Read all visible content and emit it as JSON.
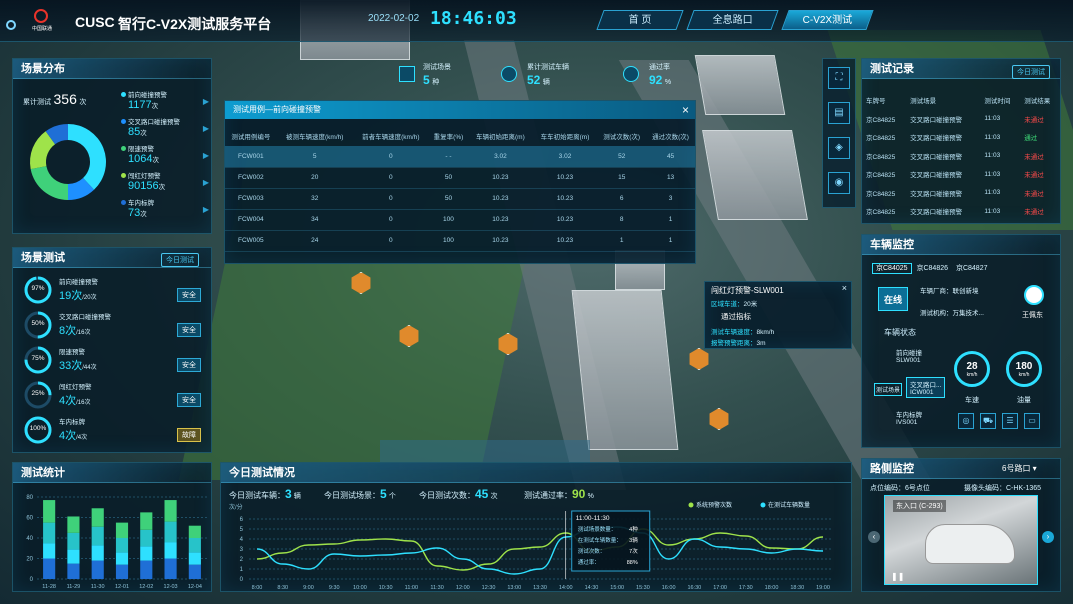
{
  "header": {
    "brand": "CUSC",
    "logo_text": "中国联通",
    "title": "智行C-V2X测试服务平台",
    "date": "2022-02-02",
    "time": "18:46:03",
    "tabs": [
      "首 页",
      "全息路口",
      "C-V2X测试"
    ],
    "active_tab": 2
  },
  "top_stats": [
    {
      "label": "测试场景",
      "value": "5",
      "unit": "种",
      "icon": "scene-icon"
    },
    {
      "label": "累计测试车辆",
      "value": "52",
      "unit": "辆",
      "icon": "car-icon"
    },
    {
      "label": "通过率",
      "value": "92",
      "unit": "%",
      "icon": "pie-icon"
    }
  ],
  "scene_dist": {
    "title": "场景分布",
    "total_label": "累计测试",
    "total": "356",
    "total_unit": "次",
    "items": [
      {
        "name": "前向碰撞预警",
        "value": "1177",
        "unit": "次",
        "color": "#2ee0ff"
      },
      {
        "name": "交叉路口碰撞预警",
        "value": "85",
        "unit": "次",
        "color": "#1e90ff"
      },
      {
        "name": "限速预警",
        "value": "1064",
        "unit": "次",
        "color": "#3fd17a"
      },
      {
        "name": "闯红灯预警",
        "value": "90156",
        "unit": "次",
        "color": "#9fe34a"
      },
      {
        "name": "车内标牌",
        "value": "73",
        "unit": "次",
        "color": "#1f6fd6"
      }
    ],
    "donut": [
      0.38,
      0.12,
      0.22,
      0.18,
      0.1
    ]
  },
  "scene_test": {
    "title": "场景测试",
    "btn": "今日测试",
    "items": [
      {
        "pct": "97%",
        "pct_val": 0.97,
        "name": "前向碰撞预警",
        "value": "19次",
        "sub": "/20次",
        "status": "安全"
      },
      {
        "pct": "50%",
        "pct_val": 0.5,
        "name": "交叉路口碰撞预警",
        "value": "8次",
        "sub": "/16次",
        "status": "安全"
      },
      {
        "pct": "75%",
        "pct_val": 0.75,
        "name": "限速预警",
        "value": "33次",
        "sub": "/44次",
        "status": "安全"
      },
      {
        "pct": "25%",
        "pct_val": 0.25,
        "name": "闯红灯预警",
        "value": "4次",
        "sub": "/16次",
        "status": "安全"
      },
      {
        "pct": "100%",
        "pct_val": 1.0,
        "name": "车内标牌",
        "value": "4次",
        "sub": "/4次",
        "status": "故障"
      }
    ]
  },
  "test_stats": {
    "title": "测试统计",
    "yticks": [
      "0",
      "20",
      "40",
      "60",
      "80"
    ],
    "categories": [
      "11-28",
      "11-29",
      "11-30",
      "12-01",
      "12-02",
      "12-03",
      "12-04"
    ],
    "stacks": [
      [
        20,
        15,
        20,
        22
      ],
      [
        15,
        14,
        16,
        16
      ],
      [
        18,
        15,
        18,
        18
      ],
      [
        14,
        12,
        14,
        15
      ],
      [
        18,
        14,
        16,
        17
      ],
      [
        20,
        16,
        20,
        21
      ],
      [
        14,
        12,
        14,
        12
      ]
    ]
  },
  "today": {
    "title": "今日测试情况",
    "stats": [
      {
        "label": "今日测试车辆：",
        "value": "3",
        "unit": "辆"
      },
      {
        "label": "今日测试场景：",
        "value": "5",
        "unit": "个"
      },
      {
        "label": "今日测试次数：",
        "value": "45",
        "unit": "次"
      },
      {
        "label": "测试通过率：",
        "value": "90",
        "unit": "%"
      }
    ],
    "ylabel": "次/分",
    "yticks": [
      "0",
      "1",
      "2",
      "3",
      "4",
      "5",
      "6"
    ],
    "xticks": [
      "8:00",
      "8:30",
      "9:00",
      "9:30",
      "10:00",
      "10:30",
      "11:00",
      "11:30",
      "12:00",
      "12:30",
      "13:00",
      "13:30",
      "14:00",
      "14:30",
      "15:00",
      "15:30",
      "16:00",
      "16:30",
      "17:00",
      "17:30",
      "18:00",
      "18:30",
      "19:00"
    ],
    "legend": [
      "系统预警次数",
      "在测试车辆数量"
    ],
    "tooltip": {
      "time": "11:00-11:30",
      "rows": [
        [
          "测试场景数量：",
          "4种"
        ],
        [
          "在测试车辆数量：",
          "3辆"
        ],
        [
          "测试次数：",
          "7次"
        ],
        [
          "通过率：",
          "88%"
        ]
      ]
    }
  },
  "chart_data": {
    "type": "line",
    "x": [
      "8:00",
      "8:30",
      "9:00",
      "9:30",
      "10:00",
      "10:30",
      "11:00",
      "11:30",
      "12:00",
      "12:30",
      "13:00",
      "13:30",
      "14:00",
      "14:30",
      "15:00",
      "15:30",
      "16:00",
      "16:30",
      "17:00",
      "17:30",
      "18:00",
      "18:30",
      "19:00"
    ],
    "ylim": [
      0,
      6
    ],
    "series": [
      {
        "name": "系统预警次数",
        "color": "#9fe34a",
        "values": [
          2,
          2.6,
          3.4,
          3.5,
          3.9,
          4,
          3.8,
          1.3,
          0.9,
          1.5,
          3,
          3.2,
          4.6,
          2.8,
          3.2,
          5,
          3.4,
          4,
          4.6,
          4.3,
          3.1,
          3,
          4.2
        ]
      },
      {
        "name": "在测试车辆数量",
        "color": "#2ee0ff",
        "values": [
          3,
          1.5,
          1,
          2.5,
          2.3,
          2.4,
          2.6,
          3.1,
          2,
          1,
          0.5,
          1,
          4.2,
          5,
          5.2,
          4.6,
          2,
          4,
          3.2,
          3,
          2.6,
          3,
          2.8
        ]
      }
    ]
  },
  "table_popup": {
    "title": "测试用例—前向碰撞预警",
    "headers": [
      "测试用例编号",
      "被测车辆速度(km/h)",
      "前者车辆速度(km/h)",
      "重复率(%)",
      "车辆初始距离(m)",
      "车车初始距离(m)",
      "测试次数(次)",
      "通过次数(次)"
    ],
    "rows": [
      [
        "FCW001",
        "5",
        "0",
        "- -",
        "3.02",
        "3.02",
        "52",
        "45"
      ],
      [
        "FCW002",
        "20",
        "0",
        "50",
        "10.23",
        "10.23",
        "15",
        "13"
      ],
      [
        "FCW003",
        "32",
        "0",
        "50",
        "10.23",
        "10.23",
        "6",
        "3"
      ],
      [
        "FCW004",
        "34",
        "0",
        "100",
        "10.23",
        "10.23",
        "8",
        "1"
      ],
      [
        "FCW005",
        "24",
        "0",
        "100",
        "10.23",
        "10.23",
        "1",
        "1"
      ]
    ]
  },
  "info_popup": {
    "title": "闯红灯预警-SLW001",
    "r1l": "区域车道：",
    "r1v": "20米",
    "r2": "通过指标",
    "r3l": "测试车辆速度：",
    "r3v": "8km/h",
    "r4l": "报警预警距离：",
    "r4v": "3m"
  },
  "records": {
    "title": "测试记录",
    "btn": "今日测试",
    "headers": [
      "车牌号",
      "测试场景",
      "测试时间",
      "测试结果"
    ],
    "rows": [
      [
        "京C84825",
        "交叉路口碰撞预警",
        "11:03",
        "未通过",
        "#ff4b4b"
      ],
      [
        "京C84825",
        "交叉路口碰撞预警",
        "11:03",
        "通过",
        "#3fe07a"
      ],
      [
        "京C84825",
        "交叉路口碰撞预警",
        "11:03",
        "未通过",
        "#ff4b4b"
      ],
      [
        "京C84825",
        "交叉路口碰撞预警",
        "11:03",
        "未通过",
        "#ff4b4b"
      ],
      [
        "京C84825",
        "交叉路口碰撞预警",
        "11:03",
        "未通过",
        "#ff4b4b"
      ],
      [
        "京C84825",
        "交叉路口碰撞预警",
        "11:03",
        "未通过",
        "#ff4b4b"
      ]
    ]
  },
  "vehicle": {
    "title": "车辆监控",
    "plates": [
      "京C84025",
      "京C84826",
      "京C84827"
    ],
    "online": "在线",
    "maker": "车辆厂商：联创新境",
    "company": "测试机构：万集技术...",
    "driver": "王佩东",
    "status_title": "车辆状态",
    "s1": "前向碰撞",
    "s1b": "SLW001",
    "s2": "交叉路口...",
    "s2b": "ICW001",
    "s3": "车内标牌",
    "s3b": "IVS001",
    "speed": "28",
    "speed_unit": "km/h",
    "speed_label": "车速",
    "acc": "180",
    "acc_unit": "km/h",
    "acc_label": "油量",
    "tag": "测试场景"
  },
  "roadside": {
    "title": "路侧监控",
    "select": "6号路口",
    "point_label": "点位编码：",
    "point": "6号点位",
    "cam_label": "摄像头编码：",
    "cam": "C-HK-1365",
    "video_label": "东入口 (C-293)"
  },
  "map_icons": [
    "warning-icon",
    "car-icon",
    "traffic-light-icon",
    "car-icon"
  ]
}
